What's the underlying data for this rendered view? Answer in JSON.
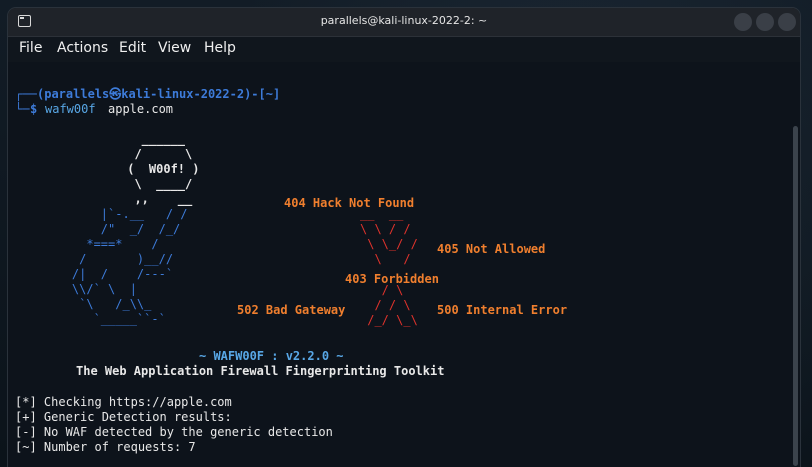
{
  "window": {
    "title": "parallels@kali-linux-2022-2: ~"
  },
  "menu": {
    "file": "File",
    "actions": "Actions",
    "edit": "Edit",
    "view": "View",
    "help": "Help"
  },
  "prompt": {
    "user_line": "(parallels㉿kali-linux-2022-2)-[~]",
    "symbol": "$",
    "command": "wafw00f",
    "argument": "apple.com"
  },
  "ascii": {
    "woof_box": [
      "   ______",
      "  /      \\",
      " (  W00f! )",
      "  \\  ____/",
      "  ,,    __"
    ],
    "dog": [
      "        |`-.__   / /",
      "        /\"  _/  /_/",
      "      *===*    /",
      "     /       )__//",
      "    /|  /    /---`",
      "    \\\\/` \\  |",
      "     `\\   /_\\\\_",
      "       `_____``-`"
    ],
    "x_mark": [
      "______  ______",
      "\\  \\  /  /",
      " \\  \\/  /",
      "  \\    /",
      "   /  \\",
      "  / /\\ \\",
      " /_/  \\_\\"
    ],
    "x_lines": [
      "__  __",
      "\\ \\ / /",
      " \\ \\_/ /",
      "  \\   /",
      "   / \\",
      "  / / \\",
      " /_/ \\_\\"
    ]
  },
  "errors": {
    "e404": "404 Hack Not Found",
    "e405": "405 Not Allowed",
    "e403": "403 Forbidden",
    "e502": "502 Bad Gateway",
    "e500": "500 Internal Error"
  },
  "banner": {
    "version": "~ WAFW00F : v2.2.0 ~",
    "tagline": "The Web Application Firewall Fingerprinting Toolkit"
  },
  "output": [
    "[*] Checking https://apple.com",
    "[+] Generic Detection results:",
    "[-] No WAF detected by the generic detection",
    "[~] Number of requests: 7"
  ]
}
